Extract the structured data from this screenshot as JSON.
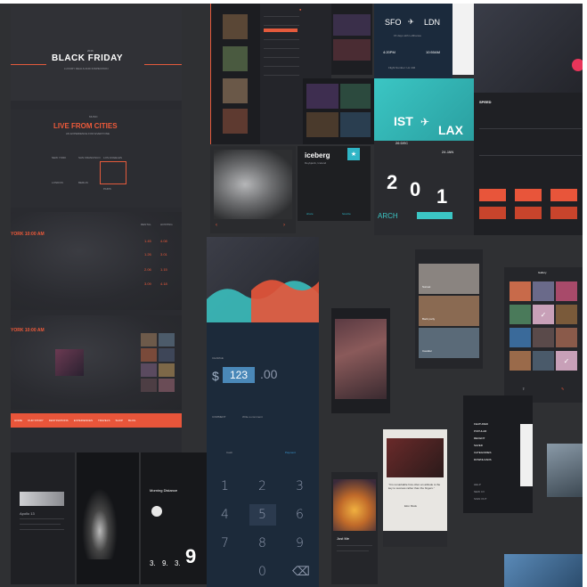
{
  "web": {
    "hero_brand": "BLACK FRIDAY",
    "hero_eyebrow": "2016",
    "hero_sub": "LUXURY DEALS AND INSPIRATION",
    "live_title": "LIVE FROM CITIES",
    "live_eyebrow": "MUSIC",
    "live_sub": "AN EXPERIENCE FOR EVERYONE",
    "live_options": [
      "NEW YORK",
      "SAN FRANCISCO",
      "LOS ANGELES",
      "LONDON",
      "BERLIN",
      "PARIS"
    ],
    "map1_time": "YORK 10:00 AM",
    "map1_legend": [
      "RENTAL",
      "HOSTING"
    ],
    "map1_prices": [
      "1.45",
      "4.08",
      "1.26",
      "3.01",
      "2.06",
      "1.15",
      "3.09",
      "4.18"
    ],
    "map2_time": "YORK 10:00 AM",
    "nav_items": [
      "HOME",
      "OUR STORY",
      "DESTINATIONS",
      "EXPERIENCES",
      "TRAVELS",
      "SHOP",
      "BLOG"
    ]
  },
  "mobile": {
    "flight_from": "SFO",
    "flight_to": "LDN",
    "flight_date": "15 days with Lufthansa",
    "flight_dep_time": "4:20PM",
    "flight_arr_time": "10:50AM",
    "flight_note": "Flight Number: LH 446",
    "route_from": "IST",
    "route_to": "LAX",
    "route_date_from": "26 DEC",
    "route_date_to": "24 JAN",
    "digits": [
      "2",
      "0",
      "1"
    ],
    "search_label": "ARCH",
    "speed_title": "SPEED",
    "card_title": "iceberg",
    "card_subtitle": "Reykjavik, Iceland",
    "card_actions": [
      "share",
      "favorite"
    ],
    "payment_charge": "CHARGE",
    "payment_amount": "123",
    "payment_cents": ".00",
    "payment_comment": "COMMENT",
    "payment_comment_value": "Write a comment",
    "payment_tabs": [
      "Cash",
      "Payment"
    ],
    "keypad": [
      "1",
      "2",
      "3",
      "4",
      "5",
      "6",
      "7",
      "8",
      "9",
      "",
      "0",
      "⌫"
    ],
    "menu_items": [
      "FEATURED",
      "POPULAR",
      "RECENT",
      "SAVED",
      "CATEGORIES",
      "DOWNLOADS"
    ],
    "menu_bottom": [
      "HELP",
      "NEW CV",
      "SIGN OUT"
    ],
    "gallery_title": "Gallery",
    "weather_title": "Morning Distance",
    "weather_temp": "9",
    "weather_stats": [
      "3.",
      "9.",
      "3."
    ],
    "quote": "“It is remarkable how often an attitude is the key to success rather than the fingers.”",
    "quote_author": "Elon Musk",
    "feed_title": "Just Me",
    "story_title": "Apollo 13",
    "story_labels": [
      "Sunset",
      "Back party",
      "Cavalier"
    ]
  },
  "colors": {
    "accent": "#ee5a3a",
    "teal": "#3ab5b5",
    "navy": "#1d2a3a"
  }
}
